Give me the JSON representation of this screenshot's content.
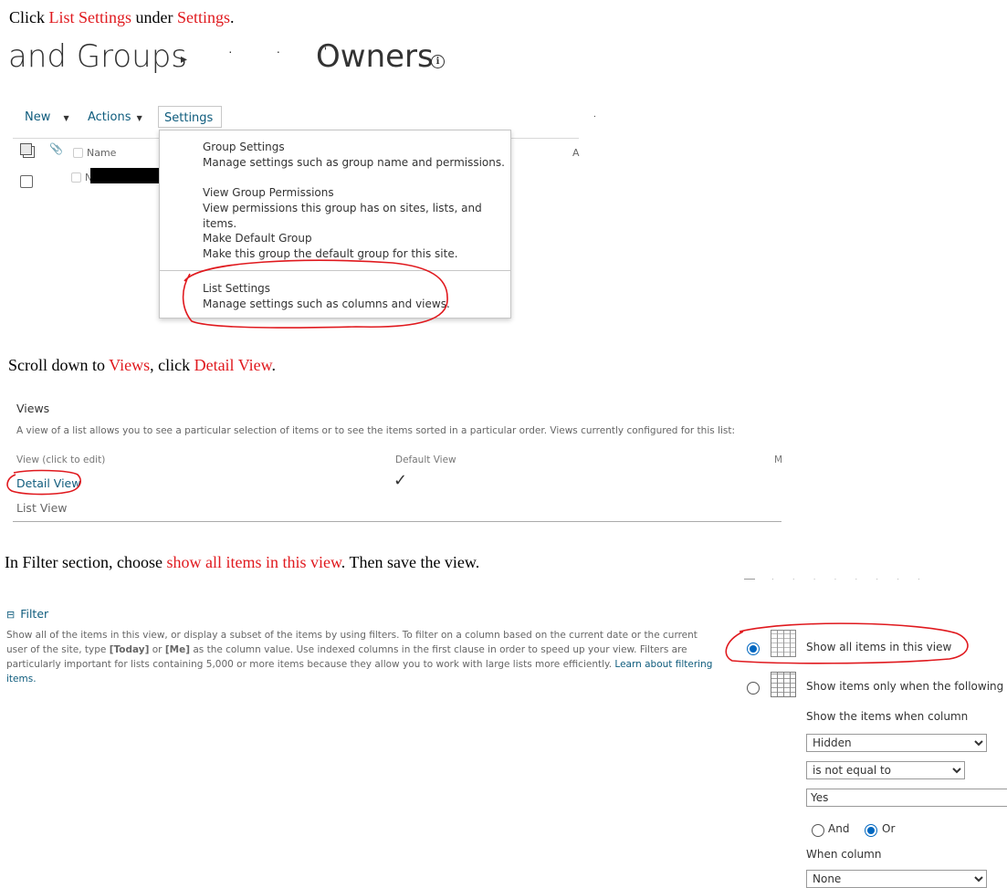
{
  "step1": {
    "prefix": "Click ",
    "target": "List Settings",
    "middle": " under ",
    "menu": "Settings",
    "suffix": "."
  },
  "header": {
    "title_left": "and Groups",
    "separator": "▸",
    "title_right": "Owners",
    "info_icon": "info-icon"
  },
  "toolbar": {
    "new_label": "New",
    "actions_label": "Actions",
    "settings_label": "Settings"
  },
  "list_header": {
    "name_label": "Name",
    "extra_col": "A"
  },
  "settings_menu": {
    "items": [
      {
        "title": "Group Settings",
        "desc": "Manage settings such as group name and permissions."
      },
      {
        "title": "View Group Permissions",
        "desc": "View permissions this group has on sites, lists, and items."
      },
      {
        "title": "Make Default Group",
        "desc": "Make this group the default group for this site."
      },
      {
        "title": "List Settings",
        "desc": "Manage settings such as columns and views."
      }
    ]
  },
  "step2": {
    "prefix": "Scroll down to ",
    "target1": "Views",
    "middle": ", click ",
    "target2": "Detail View",
    "suffix": "."
  },
  "views": {
    "heading": "Views",
    "description": "A view of a list allows you to see a particular selection of items or to see the items sorted in a particular order. Views currently configured for this list:",
    "col_view": "View (click to edit)",
    "col_default": "Default View",
    "col_m": "M",
    "rows": [
      {
        "name": "Detail View",
        "default_mark": "✓"
      },
      {
        "name": "List View",
        "default_mark": ""
      }
    ]
  },
  "step3": {
    "prefix": "In Filter section, choose ",
    "target": "show all items in this view",
    "suffix": ". Then save the view."
  },
  "filter": {
    "toggle": "⊟",
    "heading": "Filter",
    "desc_1": "Show all of the items in this view, or display a subset of the items by using filters. To filter on a column based on the current date or the current user of the site, type ",
    "today": "[Today]",
    "or": " or ",
    "me": "[Me]",
    "desc_2": " as the column value. Use indexed columns in the first clause in order to speed up your view. Filters are particularly important for lists containing 5,000 or more items because they allow you to work with large lists more efficiently. ",
    "learn_more": "Learn about filtering items.",
    "option_all": "Show all items in this view",
    "option_some": "Show items only when the following is true:",
    "show_when_label": "Show the items when column",
    "column_value": "Hidden",
    "operator_value": "is not equal to",
    "value_text": "Yes",
    "and_label": "And",
    "or_label": "Or",
    "when_column_label": "When column",
    "second_column_value": "None"
  },
  "colors": {
    "annotation_red": "#e0191e",
    "link": "#0f5c7d",
    "radio_selected": "#0067c0"
  }
}
